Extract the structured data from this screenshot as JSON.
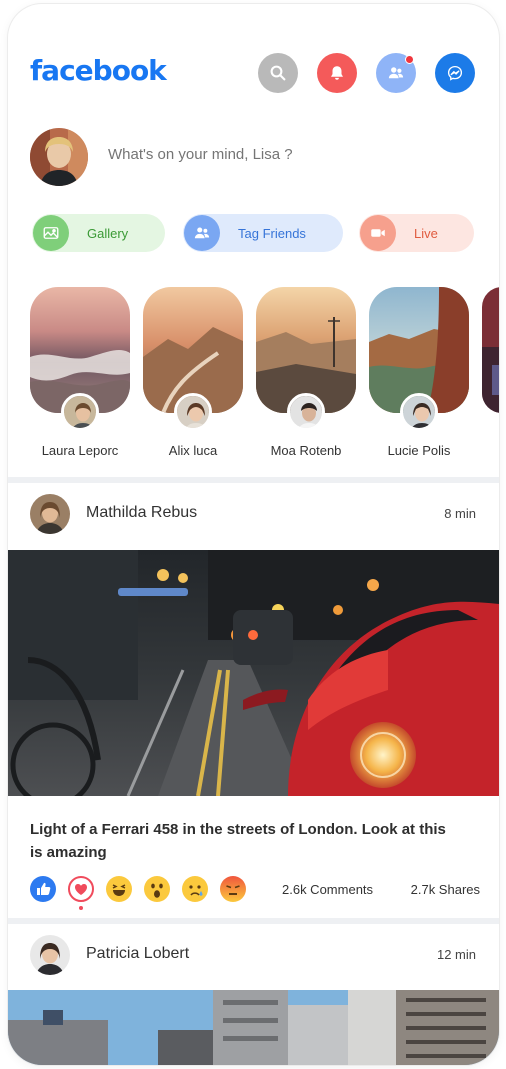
{
  "app": {
    "logo": "facebook"
  },
  "header": {
    "icons": [
      "search-icon",
      "bell-icon",
      "friends-icon",
      "messenger-icon"
    ],
    "colors": {
      "search": "#b9b9b9",
      "bell": "#f45a5a",
      "friends": "#8fb4f7",
      "messenger": "#1c7be8",
      "badge": "#f0353d"
    }
  },
  "composer": {
    "placeholder": "What's on your mind, Lisa ?"
  },
  "actions": [
    {
      "label": "Gallery",
      "icon": "image-icon",
      "bg": "#e4f6e2",
      "icon_bg": "#7fcf7a",
      "text_color": "#3b9a36"
    },
    {
      "label": "Tag Friends",
      "icon": "tag-friends-icon",
      "bg": "#dfeafc",
      "icon_bg": "#7aa7f2",
      "text_color": "#3674d8"
    },
    {
      "label": "Live",
      "icon": "video-icon",
      "bg": "#fde6e1",
      "icon_bg": "#f6a08d",
      "text_color": "#e05b3f"
    }
  ],
  "stories": [
    {
      "name": "Laura Leporc"
    },
    {
      "name": "Alix luca"
    },
    {
      "name": "Moa Rotenb"
    },
    {
      "name": "Lucie Polis"
    }
  ],
  "posts": [
    {
      "author": "Mathilda Rebus",
      "time": "8 min",
      "caption": "Light of a Ferrari 458 in the streets of London. Look at this is amazing",
      "comments": "2.6k Comments",
      "shares": "2.7k Shares",
      "reactions": [
        "like-icon",
        "love-icon",
        "haha-icon",
        "wow-icon",
        "sad-icon",
        "angry-icon"
      ]
    },
    {
      "author": "Patricia Lobert",
      "time": "12 min"
    }
  ]
}
